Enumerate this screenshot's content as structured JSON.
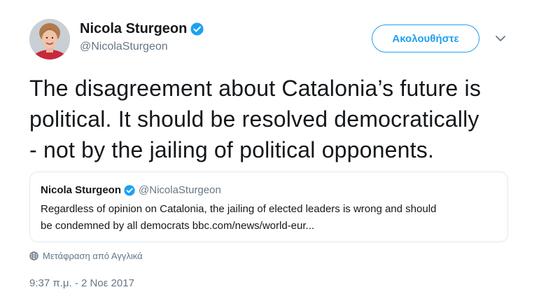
{
  "author": {
    "name": "Nicola Sturgeon",
    "handle": "@NicolaSturgeon",
    "verified": true
  },
  "follow_button": {
    "label": "Ακολουθήστε"
  },
  "menu": {
    "icon": "chevron-down-icon"
  },
  "tweet": {
    "lines": [
      "The disagreement about Catalonia’s future is",
      "political. It should be resolved democratically",
      "- not by the jailing of political opponents."
    ]
  },
  "quoted_tweet": {
    "name": "Nicola Sturgeon",
    "handle": "@NicolaSturgeon",
    "verified": true,
    "lines": [
      "Regardless of opinion on Catalonia, the jailing of elected leaders is wrong and should",
      "be condemned by all democrats bbc.com/news/world-eur..."
    ]
  },
  "translate": {
    "icon": "globe-icon",
    "label": "Μετάφραση από Αγγλικά"
  },
  "timestamp": "9:37 π.μ. - 2 Νοε 2017",
  "colors": {
    "accent": "#1da1f2",
    "text": "#14171a",
    "secondary": "#657786",
    "border": "#e1e8ed"
  }
}
